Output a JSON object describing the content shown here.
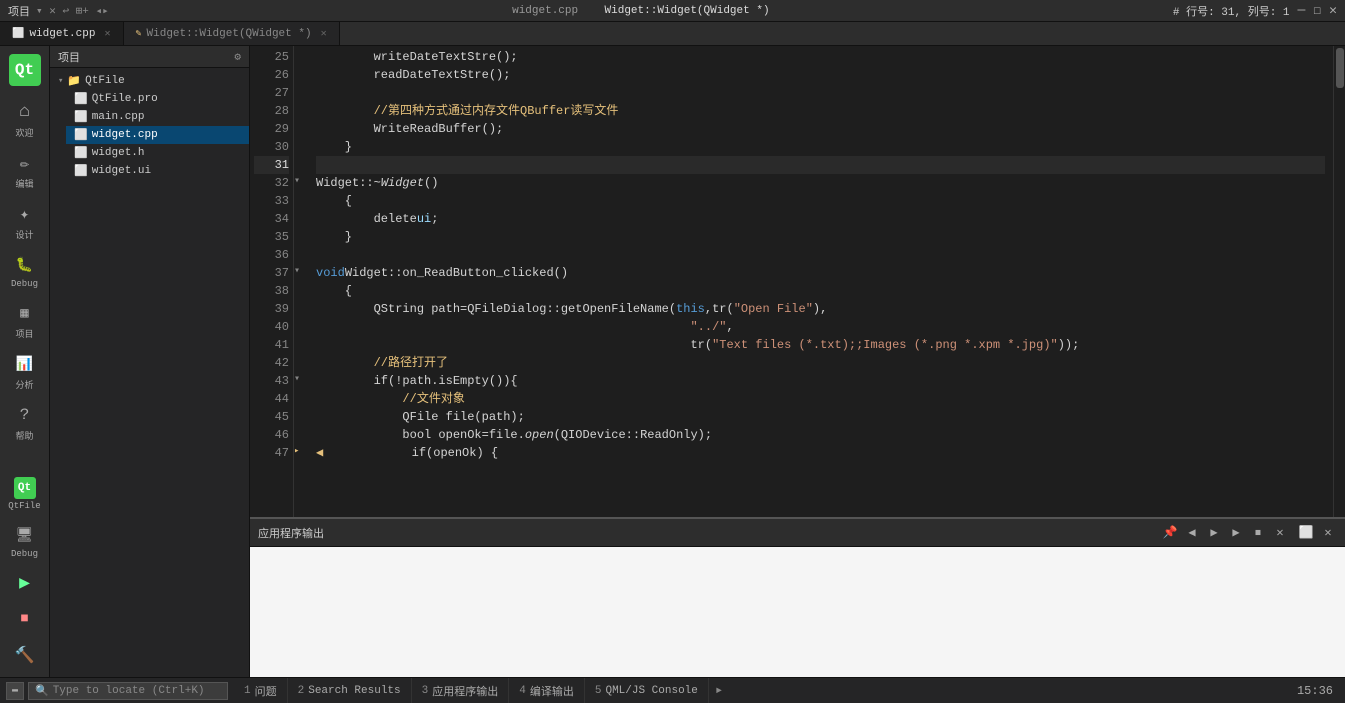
{
  "titleBar": {
    "projectLabel": "项目",
    "fileInfo": "# 行号: 31, 列号: 1",
    "tabTitle": "widget.cpp",
    "funcTitle": "Widget::Widget(QWidget *)"
  },
  "tabs": [
    {
      "id": "widget-cpp",
      "label": "widget.cpp",
      "active": true,
      "modified": false
    },
    {
      "id": "widget-widget",
      "label": "Widget::Widget(QWidget *)",
      "active": false,
      "modified": true
    }
  ],
  "sidebar": {
    "items": [
      {
        "icon": "Qt",
        "label": "欢迎"
      },
      {
        "icon": "✏",
        "label": "编辑"
      },
      {
        "icon": "✦",
        "label": "设计"
      },
      {
        "icon": "🐛",
        "label": "Debug"
      },
      {
        "icon": "📁",
        "label": "项目"
      },
      {
        "icon": "📊",
        "label": "分析"
      },
      {
        "icon": "?",
        "label": "帮助"
      }
    ],
    "bottomItems": [
      {
        "icon": "▶",
        "label": ""
      },
      {
        "icon": "🏠",
        "label": ""
      },
      {
        "icon": "🔨",
        "label": ""
      }
    ]
  },
  "fileTree": {
    "root": "QtFile",
    "items": [
      {
        "name": "QtFile.pro",
        "type": "pro",
        "depth": 1
      },
      {
        "name": "main.cpp",
        "type": "cpp",
        "depth": 1
      },
      {
        "name": "widget.cpp",
        "type": "cpp",
        "depth": 1,
        "selected": true
      },
      {
        "name": "widget.h",
        "type": "h",
        "depth": 1
      },
      {
        "name": "widget.ui",
        "type": "ui",
        "depth": 1
      }
    ]
  },
  "codeLines": [
    {
      "num": 25,
      "tokens": [
        {
          "t": "        writeDateTextStre();",
          "c": "plain"
        }
      ]
    },
    {
      "num": 26,
      "tokens": [
        {
          "t": "        readDateTextStre();",
          "c": "plain"
        }
      ]
    },
    {
      "num": 27,
      "tokens": [
        {
          "t": "",
          "c": "plain"
        }
      ]
    },
    {
      "num": 28,
      "tokens": [
        {
          "t": "        //第四种方式通过内存文件QBuffer读写文件",
          "c": "comment"
        }
      ]
    },
    {
      "num": 29,
      "tokens": [
        {
          "t": "        WriteReadBuffer();",
          "c": "plain"
        }
      ]
    },
    {
      "num": 30,
      "tokens": [
        {
          "t": "    }",
          "c": "plain"
        }
      ]
    },
    {
      "num": 31,
      "tokens": [
        {
          "t": "",
          "c": "plain"
        }
      ],
      "current": true
    },
    {
      "num": 32,
      "tokens": [
        {
          "t": "Widget::~",
          "c": "plain"
        },
        {
          "t": "Widget",
          "c": "italic plain"
        },
        {
          "t": "()",
          "c": "plain"
        }
      ],
      "foldable": true
    },
    {
      "num": 33,
      "tokens": [
        {
          "t": "    {",
          "c": "plain"
        }
      ]
    },
    {
      "num": 34,
      "tokens": [
        {
          "t": "        delete ",
          "c": "plain"
        },
        {
          "t": "ui",
          "c": "var"
        },
        {
          "t": ";",
          "c": "plain"
        }
      ]
    },
    {
      "num": 35,
      "tokens": [
        {
          "t": "    }",
          "c": "plain"
        }
      ]
    },
    {
      "num": 36,
      "tokens": [
        {
          "t": "",
          "c": "plain"
        }
      ]
    },
    {
      "num": 37,
      "tokens": [
        {
          "t": "void ",
          "c": "kw"
        },
        {
          "t": "Widget::on_ReadButton_clicked()",
          "c": "plain"
        }
      ],
      "foldable": true
    },
    {
      "num": 38,
      "tokens": [
        {
          "t": "    {",
          "c": "plain"
        }
      ]
    },
    {
      "num": 39,
      "tokens": [
        {
          "t": "        QString path=QFileDialog::getOpenFileName(",
          "c": "plain"
        },
        {
          "t": "this",
          "c": "kw"
        },
        {
          "t": ", ",
          "c": "plain"
        },
        {
          "t": "tr(",
          "c": "plain"
        },
        {
          "t": "\"Open File\"",
          "c": "str"
        },
        {
          "t": "),",
          "c": "plain"
        }
      ]
    },
    {
      "num": 40,
      "tokens": [
        {
          "t": "                                                    \"../\",",
          "c": "str"
        }
      ]
    },
    {
      "num": 41,
      "tokens": [
        {
          "t": "                                                    tr(",
          "c": "plain"
        },
        {
          "t": "\"Text files (*.txt);;Images (*.png *.xpm *.jpg)\"",
          "c": "str"
        },
        {
          "t": "));",
          "c": "plain"
        }
      ]
    },
    {
      "num": 42,
      "tokens": [
        {
          "t": "        //路径打开了",
          "c": "comment"
        }
      ]
    },
    {
      "num": 43,
      "tokens": [
        {
          "t": "        if(!path.isEmpty()){",
          "c": "plain"
        }
      ],
      "foldable": true
    },
    {
      "num": 44,
      "tokens": [
        {
          "t": "            //文件对象",
          "c": "comment"
        }
      ]
    },
    {
      "num": 45,
      "tokens": [
        {
          "t": "            QFile file(path);",
          "c": "plain"
        }
      ]
    },
    {
      "num": 46,
      "tokens": [
        {
          "t": "            bool openOk=file.",
          "c": "plain"
        },
        {
          "t": "open",
          "c": "italic plain"
        },
        {
          "t": "(QIODevice::ReadOnly);",
          "c": "plain"
        }
      ]
    },
    {
      "num": 47,
      "tokens": [
        {
          "t": "            if(openOk) {",
          "c": "plain"
        }
      ],
      "foldable": true,
      "hasArrow": true
    }
  ],
  "outputPanel": {
    "title": "应用程序输出"
  },
  "bottomTabs": [
    {
      "num": "1",
      "label": "问题"
    },
    {
      "num": "2",
      "label": "Search Results"
    },
    {
      "num": "3",
      "label": "应用程序输出"
    },
    {
      "num": "4",
      "label": "编译输出"
    },
    {
      "num": "5",
      "label": "QML/JS Console"
    }
  ],
  "searchBox": {
    "placeholder": "Type to locate (Ctrl+K)"
  },
  "statusBar": {
    "time": "15:36"
  },
  "sidebarRight": {
    "items": [
      {
        "icon": "▷",
        "label": "Debug"
      },
      {
        "icon": "▶",
        "label": ""
      },
      {
        "icon": "⏹",
        "label": ""
      },
      {
        "icon": "🔨",
        "label": ""
      }
    ]
  }
}
